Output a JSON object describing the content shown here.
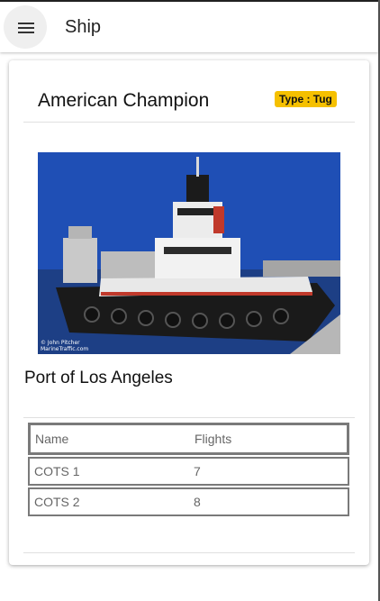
{
  "appbar": {
    "title": "Ship",
    "menu_icon": "hamburger-menu-icon"
  },
  "ship": {
    "name": "American Champion",
    "type_badge": "Type : Tug",
    "image_alt": "Tugboat American Champion",
    "photo_credit_line1": "© John Pitcher",
    "photo_credit_line2": "MarineTraffic.com",
    "home_port": "Port of Los Angeles"
  },
  "missions_table": {
    "headers": [
      "Name",
      "Flights"
    ],
    "rows": [
      [
        "COTS 1",
        "7"
      ],
      [
        "COTS 2",
        "8"
      ]
    ]
  },
  "colors": {
    "badge": "#f5c000",
    "sky": "#1f4fb5"
  }
}
